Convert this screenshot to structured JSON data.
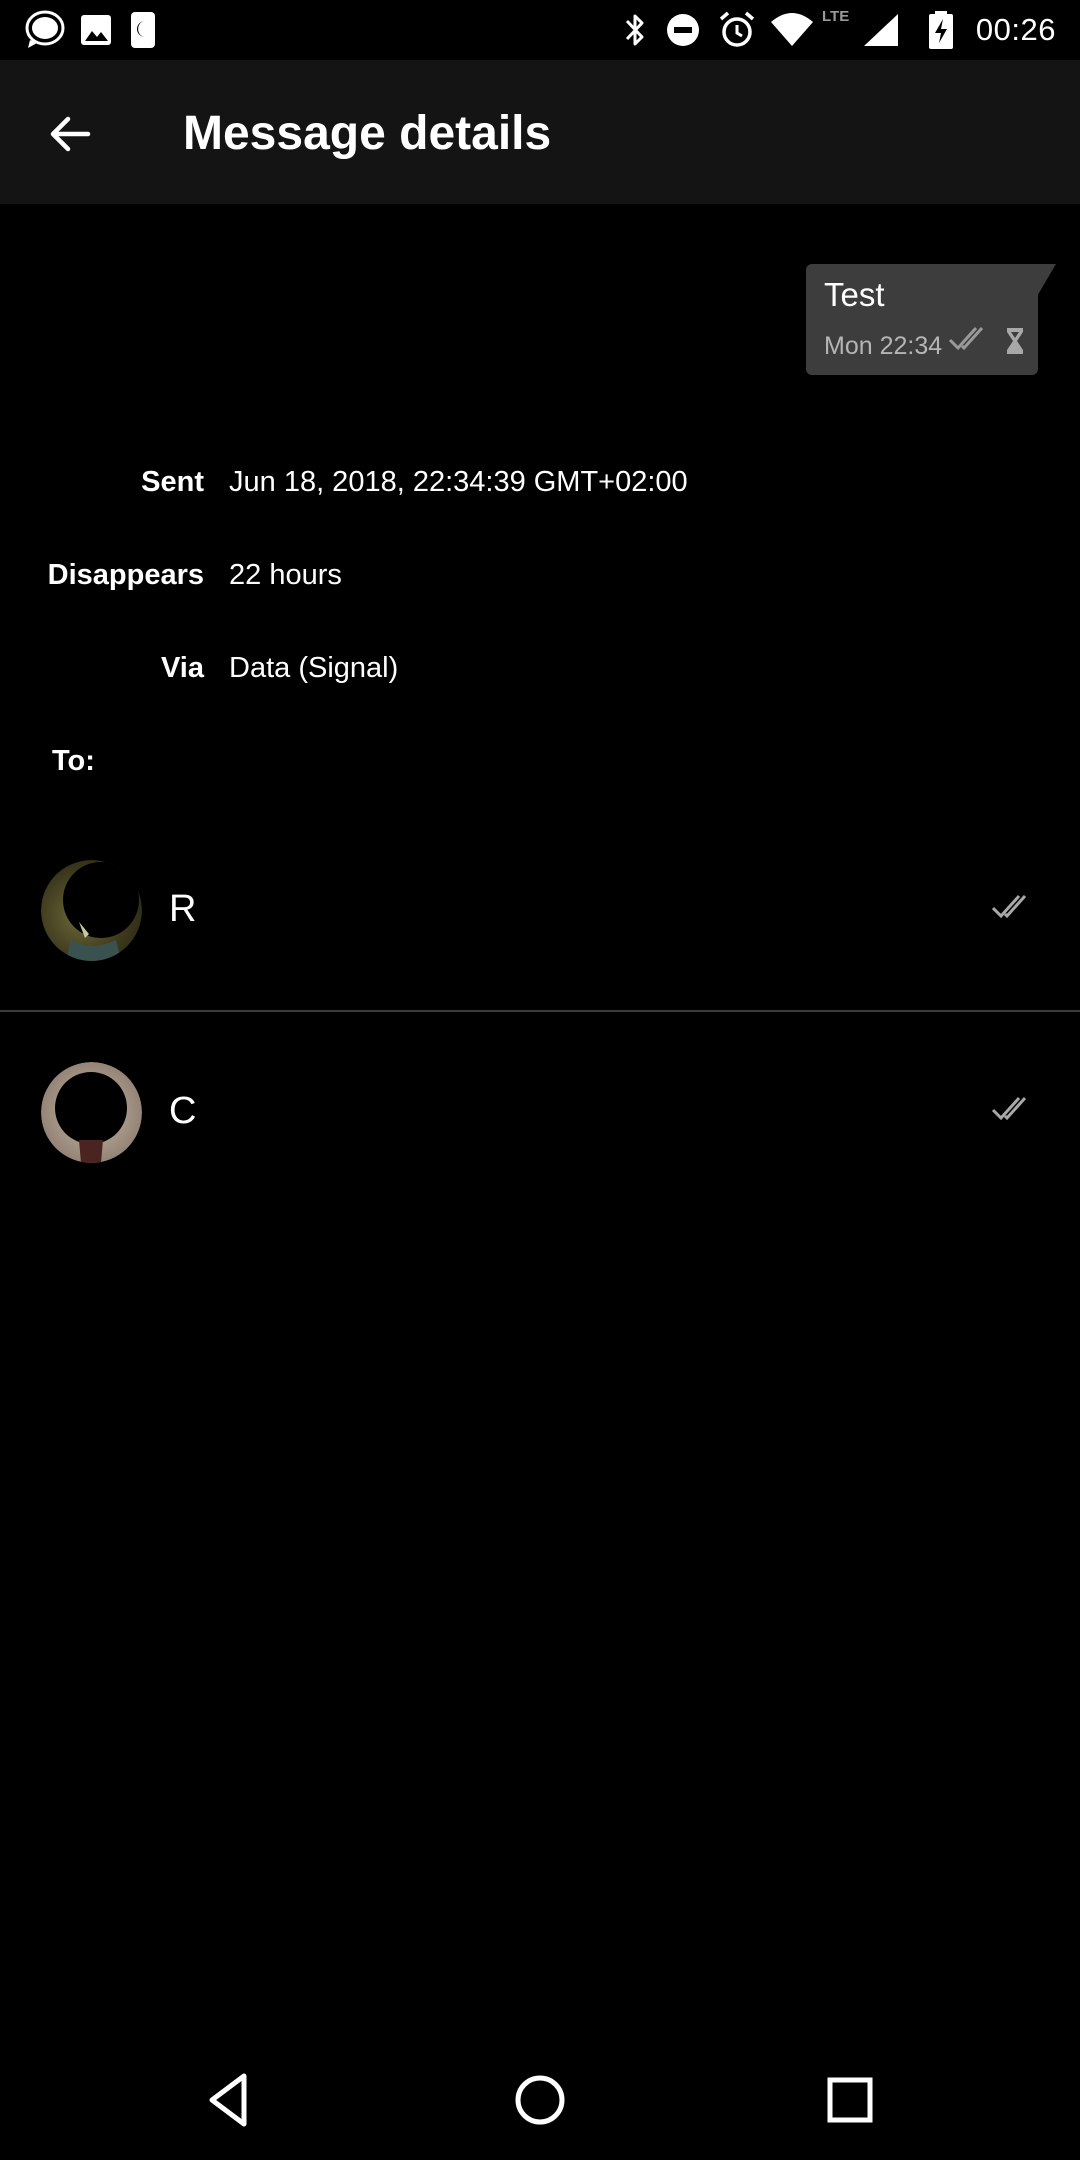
{
  "status_bar": {
    "time": "00:26",
    "left_icons": [
      "signal-app-icon",
      "image-icon",
      "night-mode-icon"
    ],
    "right_icons": [
      "bluetooth-icon",
      "do-not-disturb-icon",
      "alarm-icon",
      "wifi-icon",
      "lte-signal-icon",
      "battery-charging-icon"
    ],
    "network_label": "LTE"
  },
  "toolbar": {
    "back_icon": "arrow-left-icon",
    "title": "Message details"
  },
  "message": {
    "text": "Test",
    "time": "Mon 22:34",
    "status_icon": "double-check-icon",
    "timer_icon": "hourglass-icon"
  },
  "details": {
    "sent_label": "Sent",
    "sent_value": "Jun 18, 2018, 22:34:39 GMT+02:00",
    "disappears_label": "Disappears",
    "disappears_value": "22 hours",
    "via_label": "Via",
    "via_value": "Data (Signal)",
    "to_label": "To:"
  },
  "recipients": [
    {
      "name": "R",
      "status_icon": "double-check-icon"
    },
    {
      "name": "C",
      "status_icon": "double-check-icon"
    }
  ],
  "nav": {
    "back_icon": "nav-back-icon",
    "home_icon": "nav-home-icon",
    "recents_icon": "nav-recents-icon"
  },
  "colors": {
    "background": "#000000",
    "toolbar": "#141414",
    "bubble": "#3d3d3d",
    "secondary_text": "#b5b5b5",
    "divider": "#3a3a3a"
  }
}
